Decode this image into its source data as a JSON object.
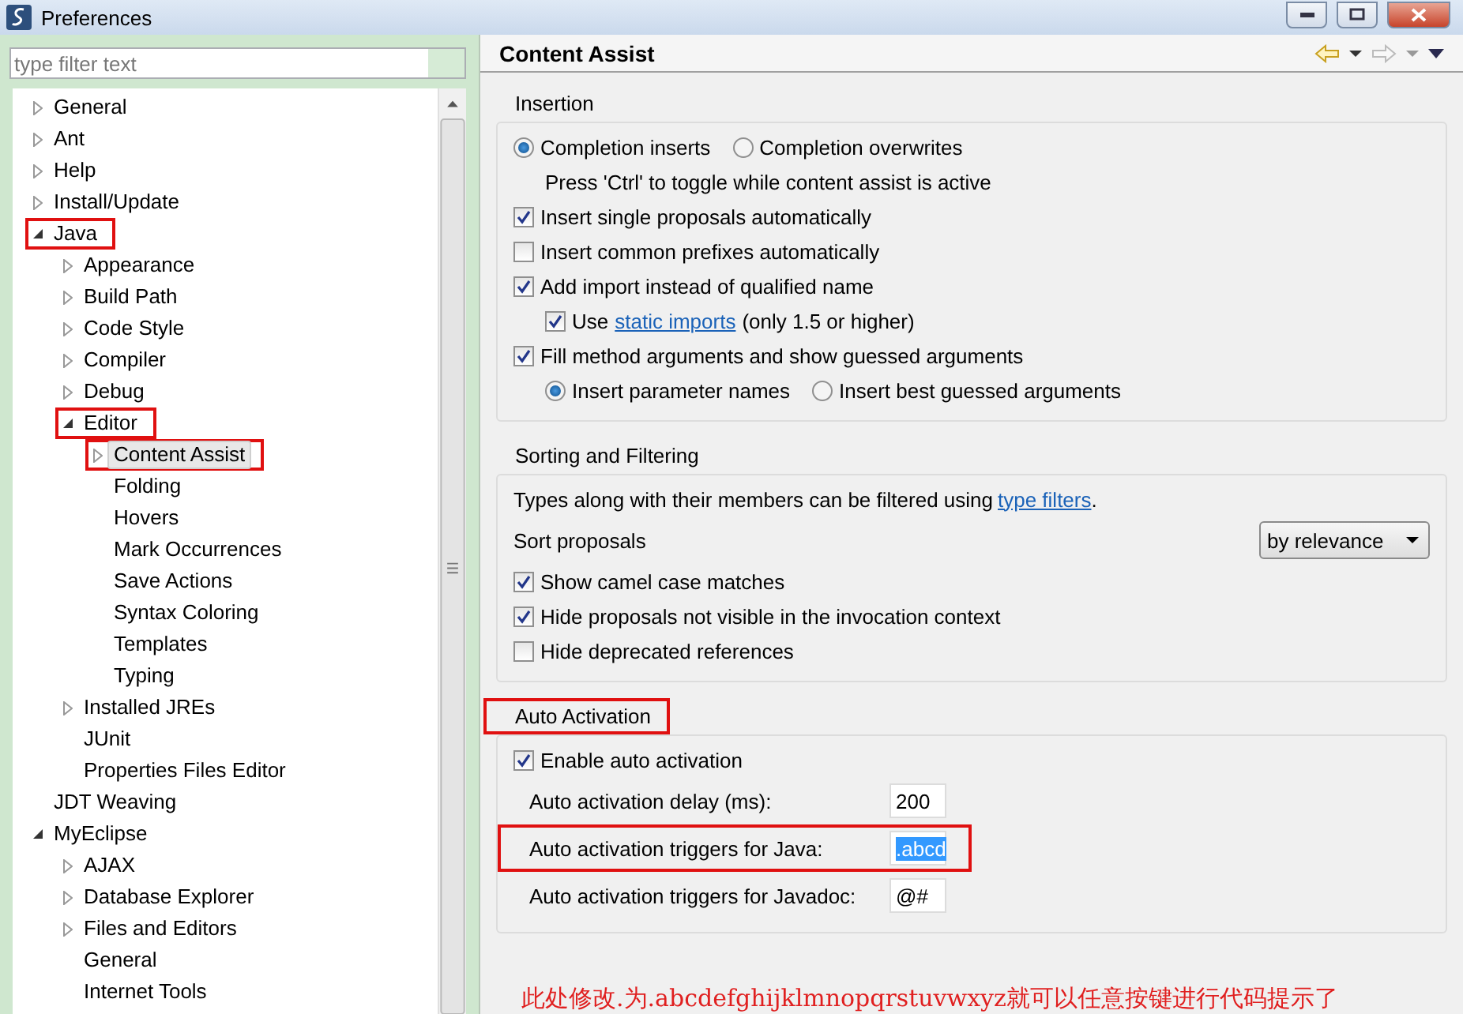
{
  "window": {
    "title": "Preferences"
  },
  "filter": {
    "placeholder": "type filter text"
  },
  "tree": [
    {
      "label": "General",
      "expanded": false,
      "selected": false,
      "highlighted": false
    },
    {
      "label": "Ant",
      "expanded": false,
      "selected": false,
      "highlighted": false
    },
    {
      "label": "Help",
      "expanded": false,
      "selected": false,
      "highlighted": false
    },
    {
      "label": "Install/Update",
      "expanded": false,
      "selected": false,
      "highlighted": false
    },
    {
      "label": "Java",
      "expanded": true,
      "selected": false,
      "highlighted": true,
      "children": [
        {
          "label": "Appearance",
          "expanded": false,
          "selected": false,
          "highlighted": false
        },
        {
          "label": "Build Path",
          "expanded": false,
          "selected": false,
          "highlighted": false
        },
        {
          "label": "Code Style",
          "expanded": false,
          "selected": false,
          "highlighted": false
        },
        {
          "label": "Compiler",
          "expanded": false,
          "selected": false,
          "highlighted": false
        },
        {
          "label": "Debug",
          "expanded": false,
          "selected": false,
          "highlighted": false
        },
        {
          "label": "Editor",
          "expanded": true,
          "selected": false,
          "highlighted": true,
          "children": [
            {
              "label": "Content Assist",
              "expanded": false,
              "selected": true,
              "highlighted": true
            },
            {
              "label": "Folding",
              "selected": false,
              "highlighted": false
            },
            {
              "label": "Hovers",
              "selected": false,
              "highlighted": false
            },
            {
              "label": "Mark Occurrences",
              "selected": false,
              "highlighted": false
            },
            {
              "label": "Save Actions",
              "selected": false,
              "highlighted": false
            },
            {
              "label": "Syntax Coloring",
              "selected": false,
              "highlighted": false
            },
            {
              "label": "Templates",
              "selected": false,
              "highlighted": false
            },
            {
              "label": "Typing",
              "selected": false,
              "highlighted": false
            }
          ]
        },
        {
          "label": "Installed JREs",
          "expanded": false,
          "selected": false,
          "highlighted": false
        },
        {
          "label": "JUnit",
          "selected": false,
          "highlighted": false
        },
        {
          "label": "Properties Files Editor",
          "selected": false,
          "highlighted": false
        }
      ]
    },
    {
      "label": "JDT Weaving",
      "selected": false,
      "highlighted": false
    },
    {
      "label": "MyEclipse",
      "expanded": true,
      "selected": false,
      "highlighted": false,
      "children": [
        {
          "label": "AJAX",
          "expanded": false,
          "selected": false,
          "highlighted": false
        },
        {
          "label": "Database Explorer",
          "expanded": false,
          "selected": false,
          "highlighted": false
        },
        {
          "label": "Files and Editors",
          "expanded": false,
          "selected": false,
          "highlighted": false
        },
        {
          "label": "General",
          "selected": false,
          "highlighted": false
        },
        {
          "label": "Internet Tools",
          "selected": false,
          "highlighted": false
        }
      ]
    }
  ],
  "page": {
    "title": "Content Assist",
    "groups": [
      {
        "title": "Insertion",
        "highlighted": false,
        "items": [
          {
            "kind": "radios",
            "options": [
              {
                "label": "Completion inserts",
                "selected": true
              },
              {
                "label": "Completion overwrites",
                "selected": false
              }
            ]
          },
          {
            "kind": "note",
            "text": "Press 'Ctrl' to toggle while content assist is active"
          },
          {
            "kind": "checkbox",
            "label": "Insert single proposals automatically",
            "checked": true
          },
          {
            "kind": "checkbox",
            "label": "Insert common prefixes automatically",
            "checked": false
          },
          {
            "kind": "checkbox",
            "label": "Add import instead of qualified name",
            "checked": true,
            "children": [
              {
                "kind": "checkbox",
                "label": "Use",
                "link": "static imports",
                "suffix": "(only 1.5 or higher)",
                "checked": true
              }
            ]
          },
          {
            "kind": "checkbox",
            "label": "Fill method arguments and show guessed arguments",
            "checked": true,
            "children": [
              {
                "kind": "radios",
                "options": [
                  {
                    "label": "Insert parameter names",
                    "selected": true
                  },
                  {
                    "label": "Insert best guessed arguments",
                    "selected": false
                  }
                ]
              }
            ]
          }
        ]
      },
      {
        "title": "Sorting and Filtering",
        "highlighted": false,
        "items": [
          {
            "kind": "text",
            "text": "Types along with their members can be filtered using",
            "link": "type filters",
            "suffix": "."
          },
          {
            "kind": "select",
            "label": "Sort proposals",
            "value": "by relevance"
          },
          {
            "kind": "checkbox",
            "label": "Show camel case matches",
            "checked": true
          },
          {
            "kind": "checkbox",
            "label": "Hide proposals not visible in the invocation context",
            "checked": true
          },
          {
            "kind": "checkbox",
            "label": "Hide deprecated references",
            "checked": false
          }
        ]
      },
      {
        "title": "Auto Activation",
        "highlighted": true,
        "items": [
          {
            "kind": "checkbox",
            "label": "Enable auto activation",
            "checked": true,
            "fields": [
              {
                "label": "Auto activation delay (ms):",
                "value": "200",
                "value_selected": false,
                "highlighted": false
              },
              {
                "label": "Auto activation triggers for Java:",
                "value": ".abcd",
                "value_selected": true,
                "highlighted": true
              },
              {
                "label": "Auto activation triggers for Javadoc:",
                "value": "@#",
                "value_selected": false,
                "highlighted": false
              }
            ]
          }
        ]
      }
    ]
  },
  "annotation": "此处修改.为.abcdefghijklmnopqrstuvwxyz就可以任意按键进行代码提示了"
}
